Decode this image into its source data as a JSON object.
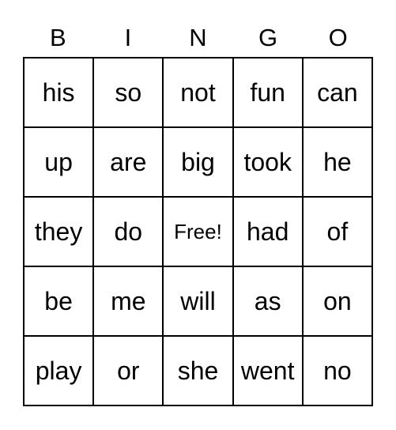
{
  "header": [
    "B",
    "I",
    "N",
    "G",
    "O"
  ],
  "rows": [
    [
      "his",
      "so",
      "not",
      "fun",
      "can"
    ],
    [
      "up",
      "are",
      "big",
      "took",
      "he"
    ],
    [
      "they",
      "do",
      "Free!",
      "had",
      "of"
    ],
    [
      "be",
      "me",
      "will",
      "as",
      "on"
    ],
    [
      "play",
      "or",
      "she",
      "went",
      "no"
    ]
  ]
}
